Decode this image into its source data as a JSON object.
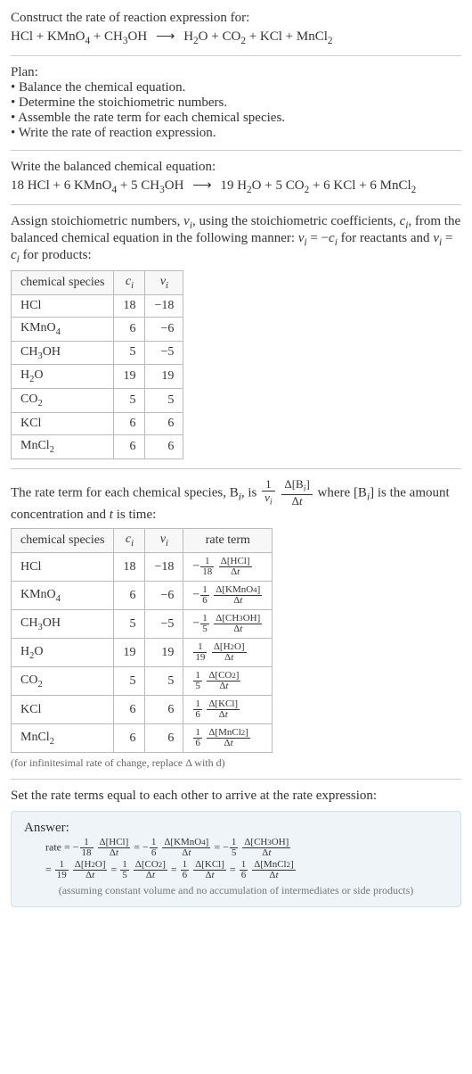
{
  "q": {
    "title": "Construct the rate of reaction expression for:",
    "eq_lhs": "HCl + KMnO",
    "eq_lhs2": " + CH",
    "eq_lhs3": "OH",
    "eq_rhs": "H",
    "eq_rhs2": "O + CO",
    "eq_rhs3": " + KCl + MnCl"
  },
  "plan": {
    "title": "Plan:",
    "b1": "• Balance the chemical equation.",
    "b2": "• Determine the stoichiometric numbers.",
    "b3": "• Assemble the rate term for each chemical species.",
    "b4": "• Write the rate of reaction expression."
  },
  "bal": {
    "title": "Write the balanced chemical equation:",
    "c1": "18 HCl + 6 KMnO",
    "c2": " + 5 CH",
    "c3": "OH",
    "c4": "19 H",
    "c5": "O + 5 CO",
    "c6": " + 6 KCl + 6 MnCl"
  },
  "stoich": {
    "intro1": "Assign stoichiometric numbers, ",
    "intro2": ", using the stoichiometric coefficients, ",
    "intro3": ", from the balanced chemical equation in the following manner: ",
    "intro4": " for reactants and ",
    "intro5": " for products:",
    "h1": "chemical species",
    "rows": [
      {
        "sp": "HCl",
        "c": "18",
        "v": "−18"
      },
      {
        "sp": "KMnO4",
        "c": "6",
        "v": "−6"
      },
      {
        "sp": "CH3OH",
        "c": "5",
        "v": "−5"
      },
      {
        "sp": "H2O",
        "c": "19",
        "v": "19"
      },
      {
        "sp": "CO2",
        "c": "5",
        "v": "5"
      },
      {
        "sp": "KCl",
        "c": "6",
        "v": "6"
      },
      {
        "sp": "MnCl2",
        "c": "6",
        "v": "6"
      }
    ]
  },
  "rateterm": {
    "intro1": "The rate term for each chemical species, B",
    "intro2": ", is ",
    "intro3": " where [B",
    "intro4": "] is the amount concentration and ",
    "t": "t",
    "intro5": " is time:",
    "h4": "rate term",
    "note": "(for infinitesimal rate of change, replace Δ with d)"
  },
  "final": {
    "title": "Set the rate terms equal to each other to arrive at the rate expression:",
    "ans": "Answer:",
    "rate": "rate = ",
    "note": "(assuming constant volume and no accumulation of intermediates or side products)"
  }
}
